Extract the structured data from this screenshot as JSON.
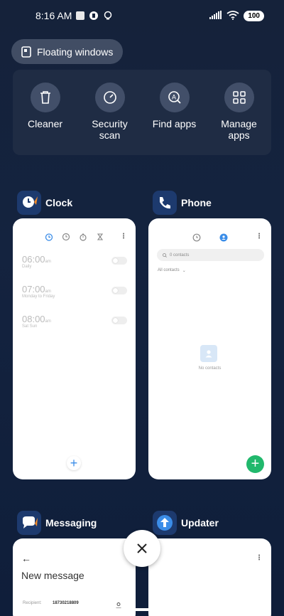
{
  "status_bar": {
    "time": "8:16 AM",
    "battery": "100"
  },
  "floating_windows": {
    "label": "Floating windows"
  },
  "quick_actions": [
    {
      "label": "Cleaner",
      "icon": "trash-icon"
    },
    {
      "label": "Security\nscan",
      "icon": "security-icon"
    },
    {
      "label": "Find apps",
      "icon": "find-apps-icon"
    },
    {
      "label": "Manage\napps",
      "icon": "grid-icon"
    }
  ],
  "apps": {
    "clock": {
      "name": "Clock",
      "icon_color": "#1d3a6e",
      "alarms": [
        {
          "time": "06:00",
          "ampm": "am",
          "sub": "Daily"
        },
        {
          "time": "07:00",
          "ampm": "am",
          "sub": "Monday to Friday"
        },
        {
          "time": "08:00",
          "ampm": "am",
          "sub": "Sat Sun"
        }
      ],
      "add_label": "+"
    },
    "phone": {
      "name": "Phone",
      "search_placeholder": "0 contacts",
      "filter": "All contacts",
      "empty_text": "No contacts",
      "add_label": "+"
    },
    "messaging": {
      "name": "Messaging",
      "title": "New message",
      "recipient_label": "Recipient:",
      "recipient_value": "18730218809"
    },
    "updater": {
      "name": "Updater"
    }
  },
  "colors": {
    "accent_blue": "#3b8de8",
    "fab_green": "#21b86c"
  }
}
